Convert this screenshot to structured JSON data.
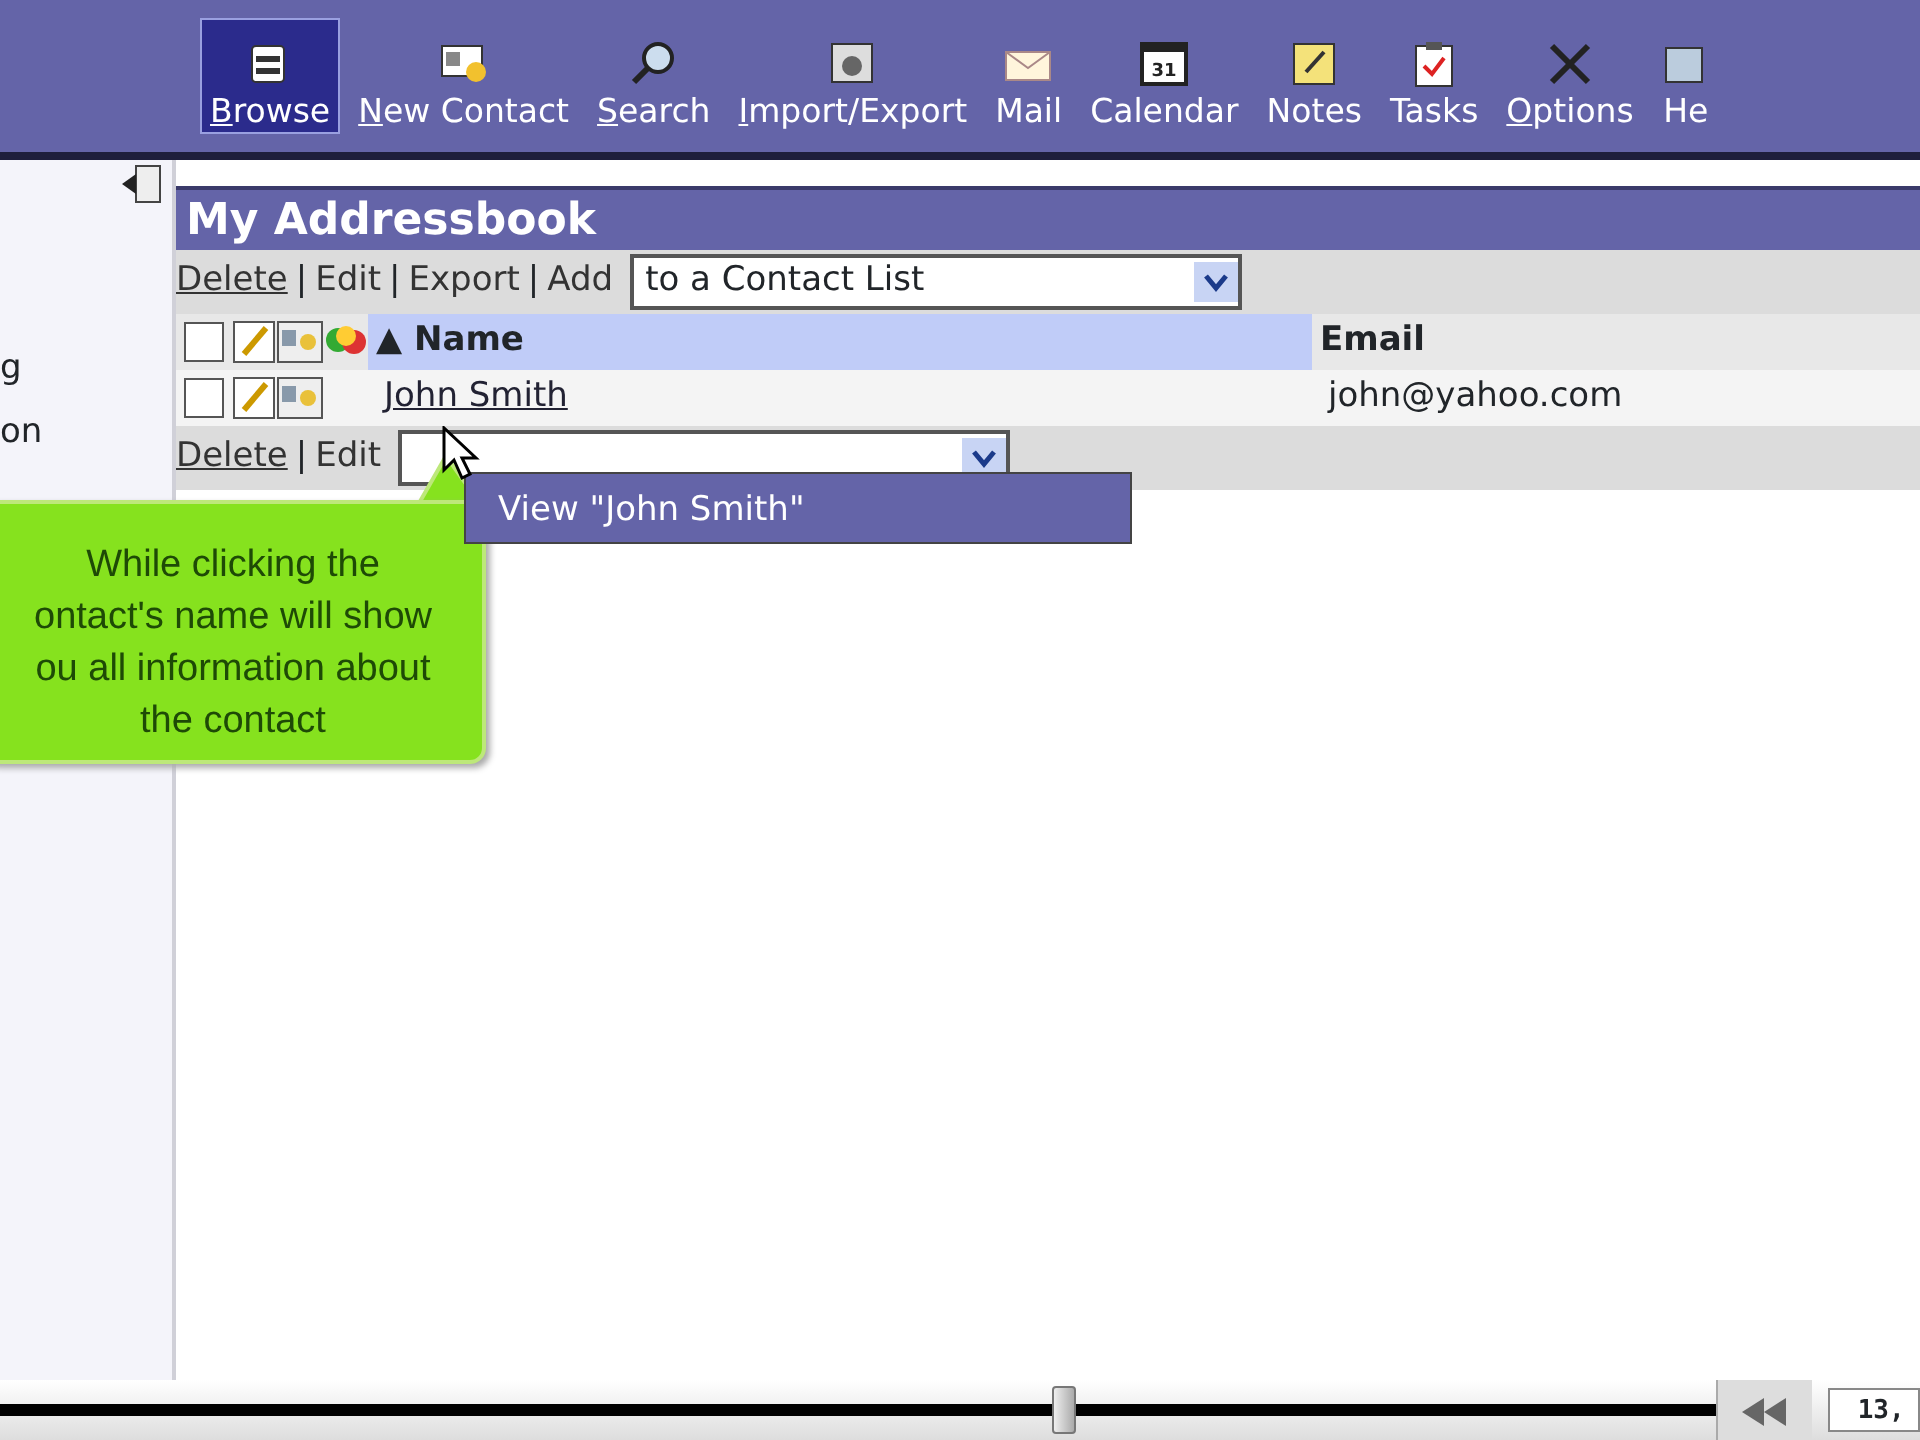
{
  "toolbar": {
    "items": [
      {
        "label": "Browse",
        "kind": "browse",
        "underlined": true,
        "selected": true
      },
      {
        "label": "New Contact",
        "kind": "new-contact",
        "underlined": true,
        "selected": false
      },
      {
        "label": "Search",
        "kind": "search",
        "underlined": true,
        "selected": false
      },
      {
        "label": "Import/Export",
        "kind": "import-export",
        "underlined": true,
        "selected": false
      },
      {
        "label": "Mail",
        "kind": "mail",
        "underlined": false,
        "selected": false
      },
      {
        "label": "Calendar",
        "kind": "calendar",
        "icon_text": "31",
        "underlined": false,
        "selected": false
      },
      {
        "label": "Notes",
        "kind": "notes",
        "underlined": false,
        "selected": false
      },
      {
        "label": "Tasks",
        "kind": "tasks",
        "underlined": false,
        "selected": false
      },
      {
        "label": "Options",
        "kind": "options",
        "underlined": true,
        "selected": false
      },
      {
        "label": "He",
        "kind": "help",
        "underlined": false,
        "selected": false
      }
    ]
  },
  "sidebar": {
    "items": [
      "g",
      "on"
    ]
  },
  "addressbook": {
    "title": "My Addressbook",
    "top_actions": {
      "links": [
        "Delete",
        "Edit",
        "Export",
        "Add"
      ],
      "separator": "|",
      "select": "to a Contact List"
    },
    "table": {
      "columns": [
        {
          "label": "Name",
          "sort": "▲",
          "sorted": true
        },
        {
          "label": "Email",
          "sorted": false
        }
      ],
      "select_all_checked": false,
      "rows": [
        {
          "checked": false,
          "name": "John Smith",
          "email": "john@yahoo.com"
        }
      ]
    },
    "bottom_actions": {
      "links": [
        "Delete",
        "Edit"
      ],
      "separator": "|"
    }
  },
  "context_menu": {
    "items": [
      "View \"John Smith\""
    ]
  },
  "callout": {
    "text": "While clicking the\nontact's name will show\nou all information about\nthe contact"
  },
  "player": {
    "level": 0.62,
    "time": "13,"
  }
}
